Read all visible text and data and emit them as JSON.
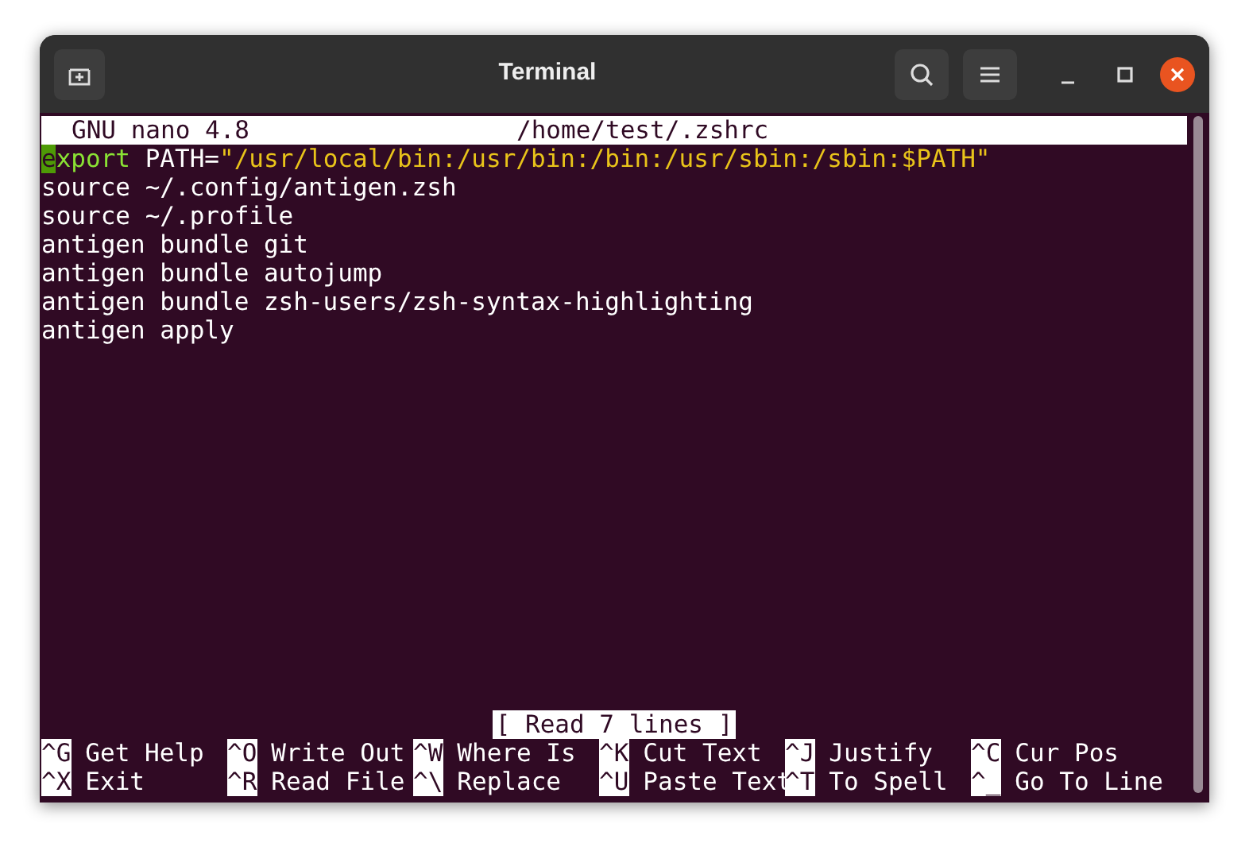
{
  "window": {
    "title": "Terminal"
  },
  "nano": {
    "header": {
      "version": "GNU nano 4.8",
      "file": "/home/test/.zshrc"
    },
    "lines": [
      {
        "segments": [
          {
            "text": "e",
            "kind": "cursor"
          },
          {
            "text": "xport",
            "kind": "keyword"
          },
          {
            "text": " PATH=",
            "kind": "plain"
          },
          {
            "text": "\"/usr/local/bin:/usr/bin:/bin:/usr/sbin:/sbin:$PATH\"",
            "kind": "string"
          }
        ]
      },
      {
        "segments": [
          {
            "text": "source ~/.config/antigen.zsh",
            "kind": "plain"
          }
        ]
      },
      {
        "segments": [
          {
            "text": "source ~/.profile",
            "kind": "plain"
          }
        ]
      },
      {
        "segments": [
          {
            "text": "antigen bundle git",
            "kind": "plain"
          }
        ]
      },
      {
        "segments": [
          {
            "text": "antigen bundle autojump",
            "kind": "plain"
          }
        ]
      },
      {
        "segments": [
          {
            "text": "antigen bundle zsh-users/zsh-syntax-highlighting",
            "kind": "plain"
          }
        ]
      },
      {
        "segments": [
          {
            "text": "antigen apply",
            "kind": "plain"
          }
        ]
      }
    ],
    "status": "[ Read 7 lines ]",
    "shortcuts": [
      {
        "key": "^G",
        "label": "Get Help"
      },
      {
        "key": "^O",
        "label": "Write Out"
      },
      {
        "key": "^W",
        "label": "Where Is"
      },
      {
        "key": "^K",
        "label": "Cut Text"
      },
      {
        "key": "^J",
        "label": "Justify"
      },
      {
        "key": "^C",
        "label": "Cur Pos"
      },
      {
        "key": "^X",
        "label": "Exit"
      },
      {
        "key": "^R",
        "label": "Read File"
      },
      {
        "key": "^\\",
        "label": "Replace"
      },
      {
        "key": "^U",
        "label": "Paste Text"
      },
      {
        "key": "^T",
        "label": "To Spell"
      },
      {
        "key": "^_",
        "label": "Go To Line"
      }
    ]
  }
}
